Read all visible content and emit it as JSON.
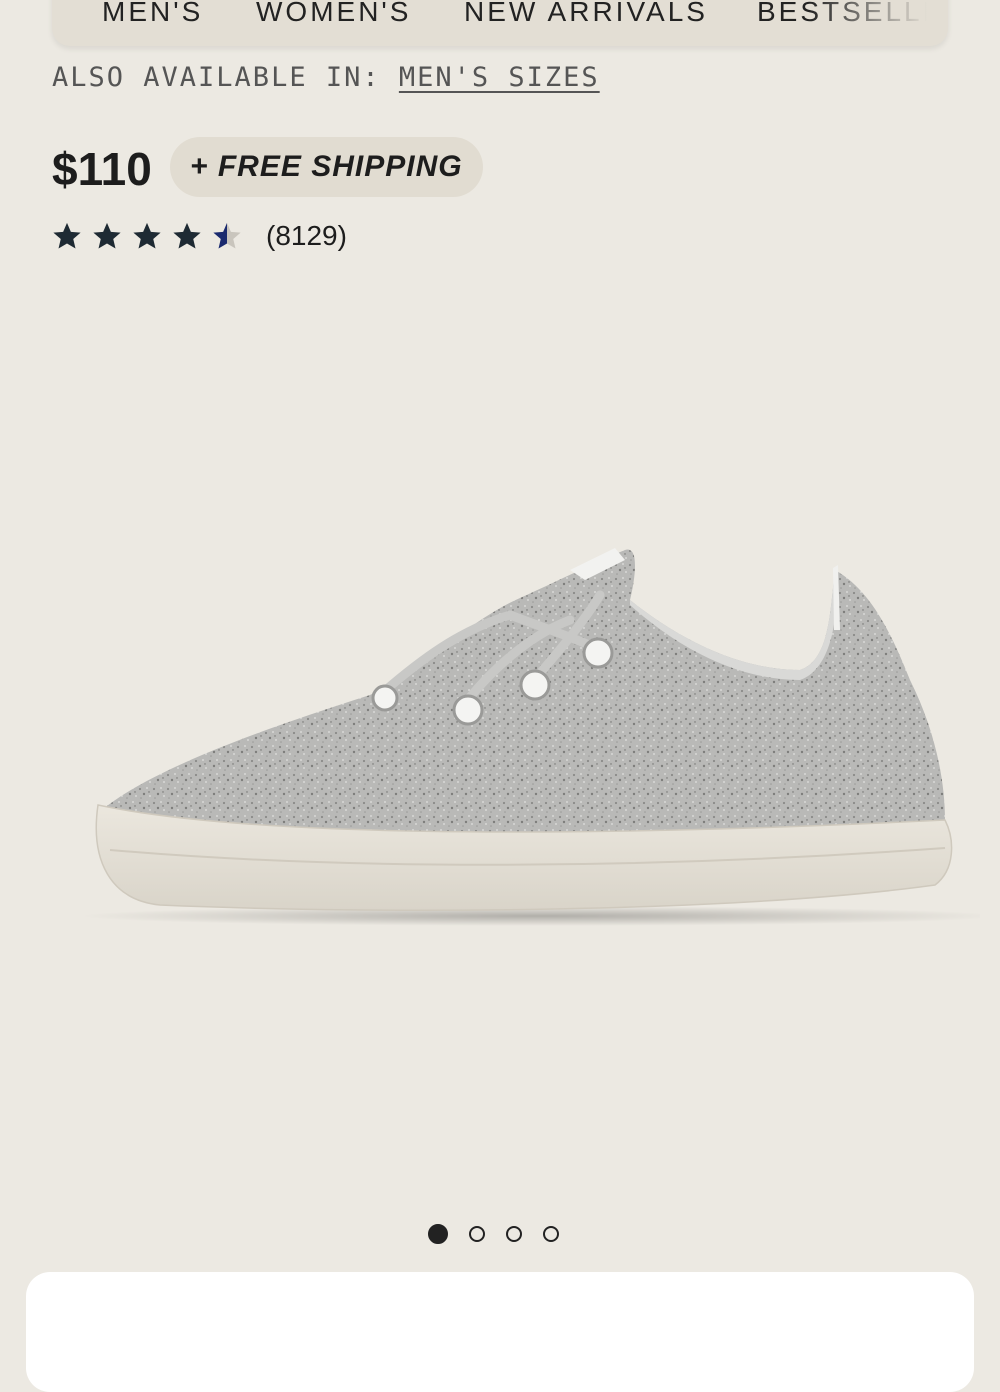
{
  "nav": {
    "items": [
      "MEN'S",
      "WOMEN'S",
      "NEW ARRIVALS",
      "BESTSELLERS"
    ]
  },
  "availability": {
    "prefix": "ALSO AVAILABLE IN:",
    "link": "MEN'S SIZES"
  },
  "product": {
    "price": "$110",
    "shipping": "+ FREE SHIPPING",
    "rating": {
      "stars": 4.5,
      "max": 5,
      "count": "(8129)"
    },
    "image_alt_icon": "shoe-icon"
  },
  "carousel": {
    "total": 4,
    "active_index": 0
  },
  "colors": {
    "background": "#ece9e2",
    "nav_bg": "#e3ded4",
    "pill_bg": "#e1dcd1",
    "star": "#1e2a33",
    "star_half_accent": "#1a2a6e",
    "text": "#1d1d1d"
  }
}
